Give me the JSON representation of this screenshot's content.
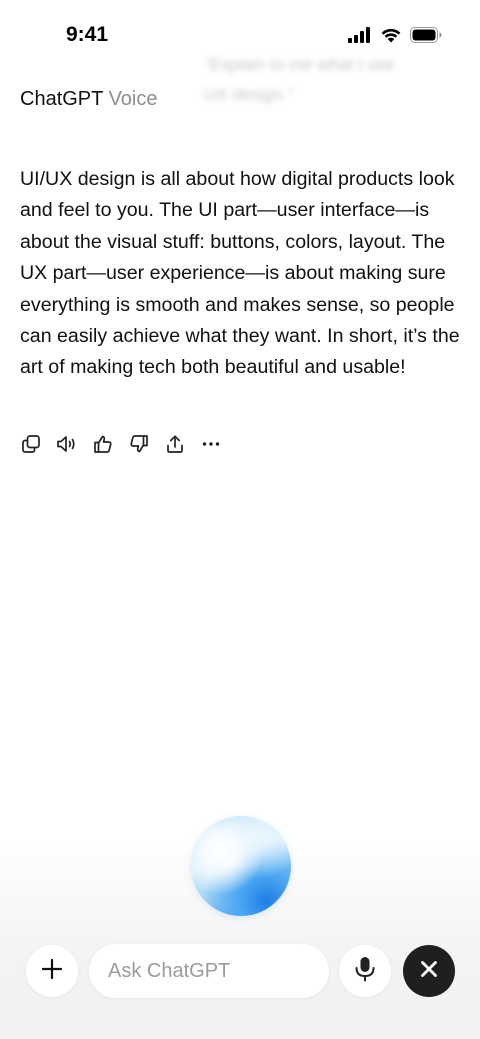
{
  "status_bar": {
    "time": "9:41",
    "icons": [
      "cellular-signal-icon",
      "wifi-icon",
      "battery-icon"
    ]
  },
  "header": {
    "app_name": "ChatGPT",
    "mode": "Voice"
  },
  "background_quote": {
    "line1": "“Explain to me what I see",
    "line2": "UX design.”"
  },
  "response": {
    "text": "UI/UX design is all about how digital products look and feel to you. The UI part—user interface—is about the visual stuff: buttons, colors, layout. The UX part—user experience—is about making sure everything is smooth and makes sense, so people can easily achieve what they want. In short, it’s the art of making tech both beautiful and usable!"
  },
  "actions": [
    {
      "name": "copy-icon"
    },
    {
      "name": "read-aloud-icon"
    },
    {
      "name": "thumbs-up-icon"
    },
    {
      "name": "thumbs-down-icon"
    },
    {
      "name": "share-icon"
    },
    {
      "name": "more-icon"
    }
  ],
  "composer": {
    "placeholder": "Ask ChatGPT",
    "value": ""
  },
  "colors": {
    "text": "#0d0d0d",
    "muted": "#8e8e8e",
    "close_button": "#1f1f1f",
    "orb_blue": "#1e7fe6"
  }
}
